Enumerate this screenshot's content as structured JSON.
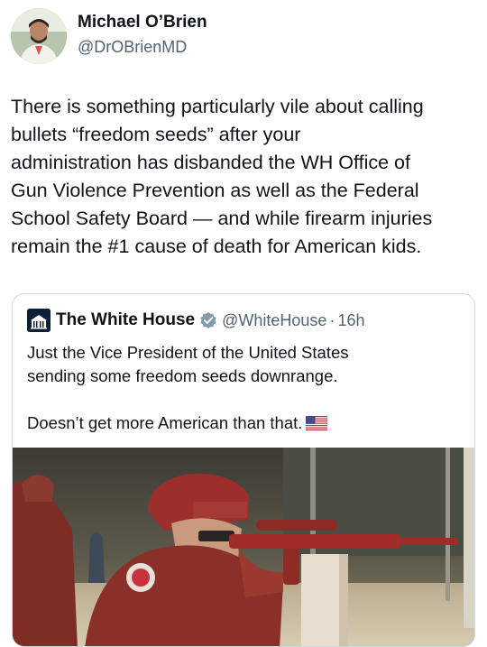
{
  "author": {
    "display_name": "Michael O’Brien",
    "handle": "@DrOBrienMD",
    "avatar_icon": "profile-photo-icon"
  },
  "tweet": {
    "text": "There is something particularly vile about calling\nbullets “freedom seeds” after your\nadministration has disbanded the WH Office of\nGun Violence Prevention as well as the Federal\nSchool Safety Board — and while firearm injuries\nremain the #1 cause of death for American kids."
  },
  "quoted_tweet": {
    "display_name": "The White House",
    "handle": "@WhiteHouse",
    "separator": "·",
    "time": "16h",
    "text": "Just the Vice President of the United States\nsending some freedom seeds downrange.\n\nDoesn’t get more American than that.",
    "flag_icon": "us-flag-icon",
    "verified_icon": "verified-badge-icon",
    "verified_color": "#829aab",
    "media_icon": "shooting-range-photo"
  }
}
